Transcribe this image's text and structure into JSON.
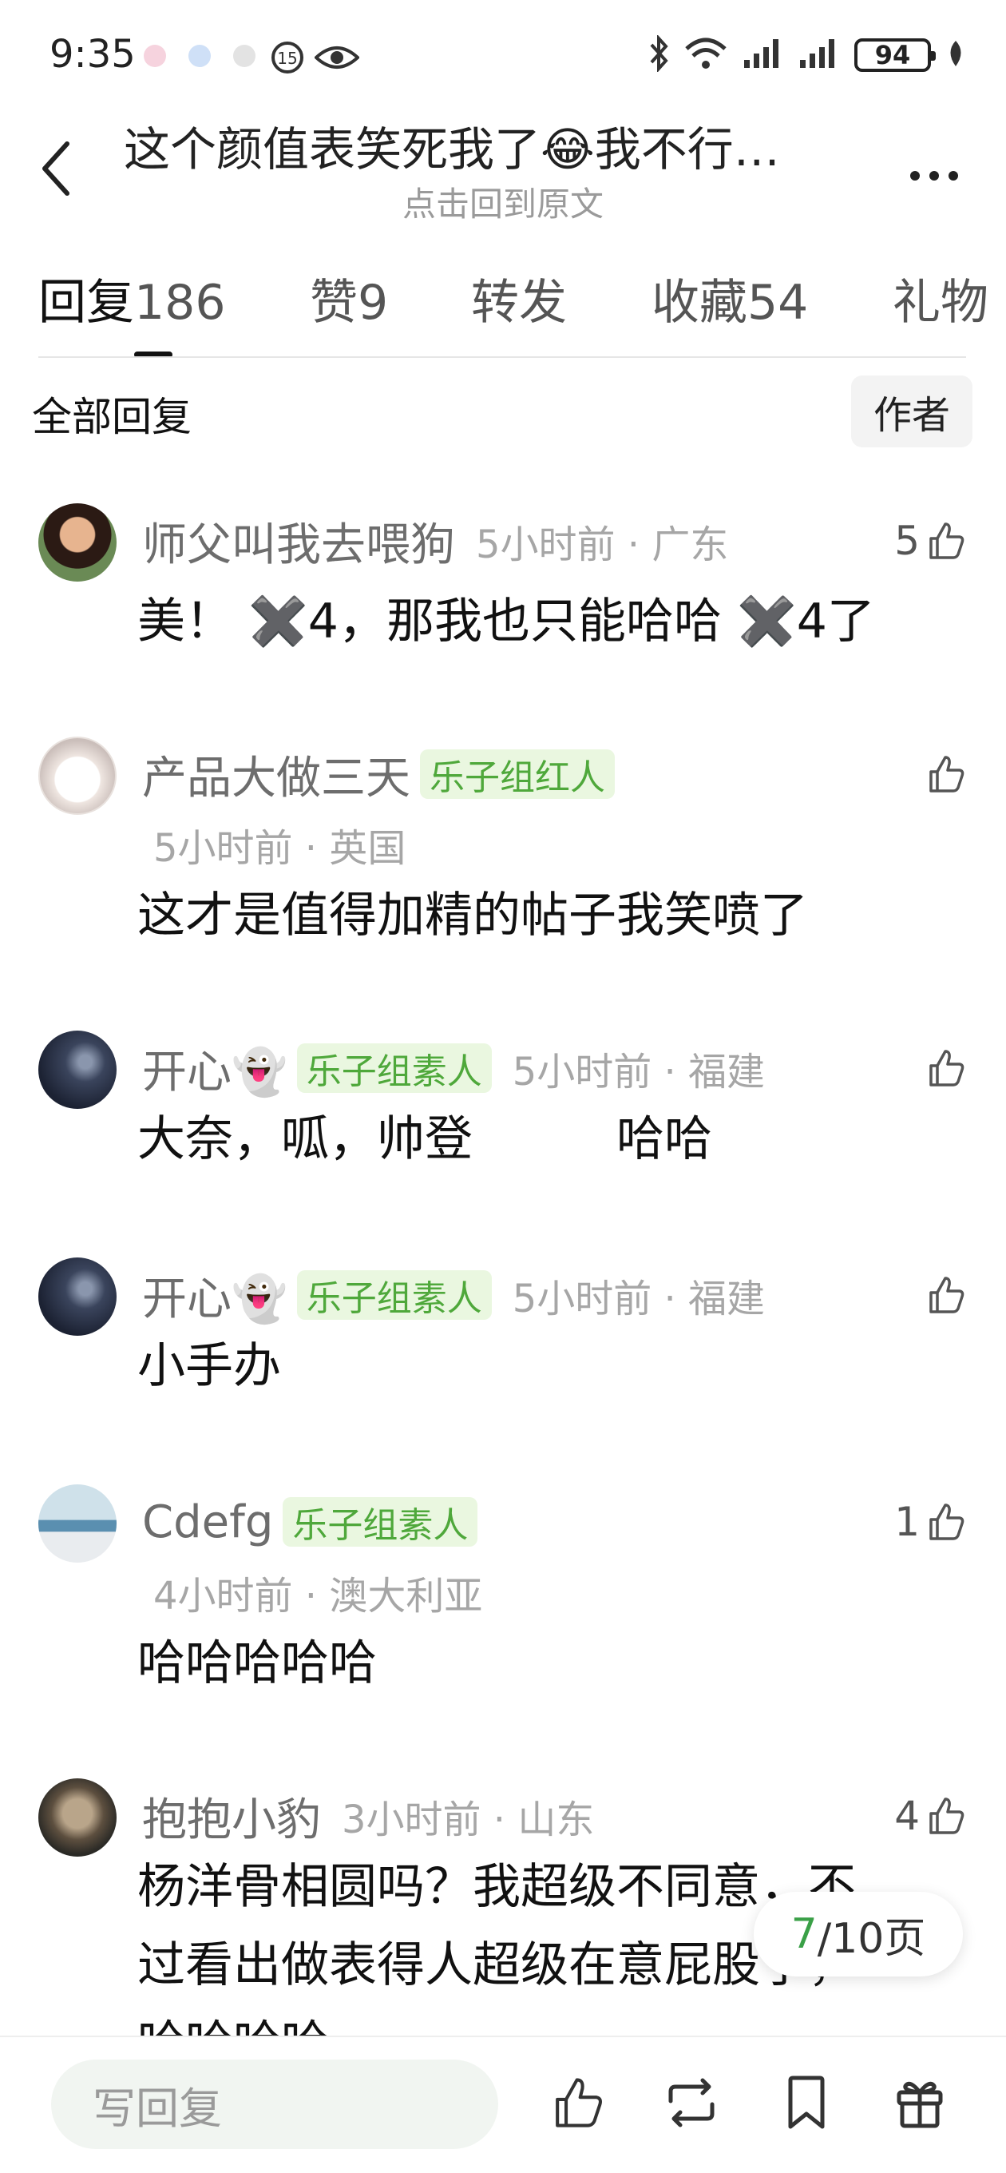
{
  "status": {
    "time": "9:35",
    "battery": "94",
    "notif_colors": [
      "#e0457b",
      "#2a7de1",
      "#9e9e9e"
    ]
  },
  "nav": {
    "title": "这个颜值表笑死我了😂我不行…",
    "subtitle": "点击回到原文"
  },
  "tabs": [
    {
      "label": "回复",
      "count": "186"
    },
    {
      "label": "赞",
      "count": "9"
    },
    {
      "label": "转发",
      "count": ""
    },
    {
      "label": "收藏",
      "count": "54"
    },
    {
      "label": "礼物",
      "count": ""
    }
  ],
  "filter": {
    "all_label": "全部回复",
    "author_label": "作者"
  },
  "comments": [
    {
      "name": "师父叫我去喂狗",
      "badge": "",
      "meta": "5小时前 · 广东",
      "meta2": "",
      "likes": "5",
      "text": "美！ ✖️4，那我也只能哈哈 ✖️4了",
      "text2": "",
      "text3": ""
    },
    {
      "name": "产品大做三天",
      "badge": "乐子组红人",
      "meta": "",
      "meta2": "5小时前 · 英国",
      "likes": "",
      "text": "这才是值得加精的帖子我笑喷了",
      "text2": "",
      "text3": ""
    },
    {
      "name": "开心👻",
      "badge": "乐子组素人",
      "meta": "5小时前 · 福建",
      "meta2": "",
      "likes": "",
      "text": "大奈，呱，帅登　　　哈哈",
      "text2": "",
      "text3": ""
    },
    {
      "name": "开心👻",
      "badge": "乐子组素人",
      "meta": "5小时前 · 福建",
      "meta2": "",
      "likes": "",
      "text": "小手办",
      "text2": "",
      "text3": ""
    },
    {
      "name": "Cdefg",
      "badge": "乐子组素人",
      "meta": "",
      "meta2": "4小时前 · 澳大利亚",
      "likes": "1",
      "text": "哈哈哈哈哈",
      "text2": "",
      "text3": ""
    },
    {
      "name": "抱抱小豹",
      "badge": "",
      "meta": "3小时前 · 山东",
      "meta2": "",
      "likes": "4",
      "text": "杨洋骨相圆吗？我超级不同意，不",
      "text2": "过看出做表得人超级在意屁股了，",
      "text3": "哈哈哈哈"
    }
  ],
  "pager": {
    "current": "7",
    "total": "/10页"
  },
  "bottom": {
    "reply_placeholder": "写回复"
  }
}
